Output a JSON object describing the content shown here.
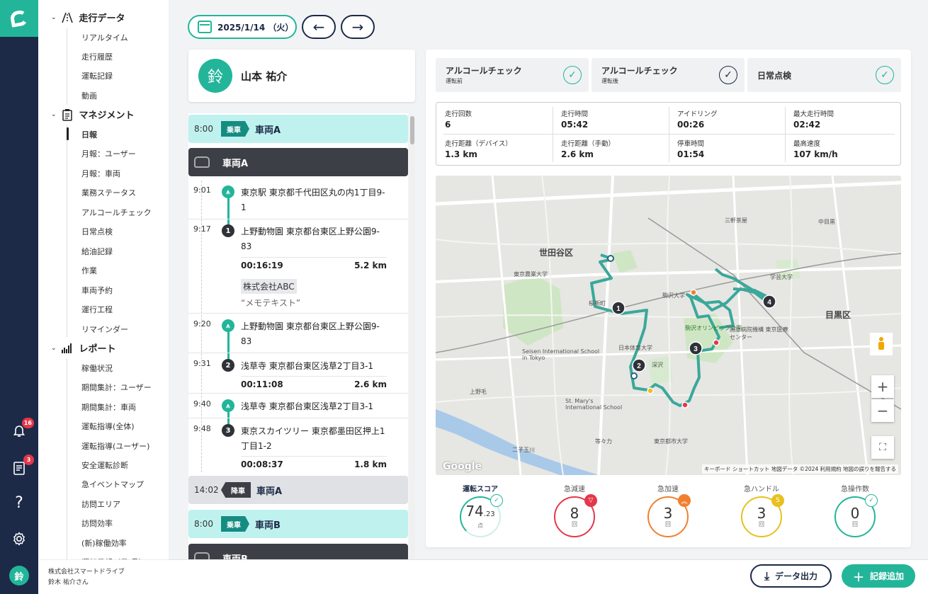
{
  "rail": {
    "notifications_badge": "16",
    "reports_badge": "3",
    "help_glyph": "?",
    "avatar_initial": "鈴"
  },
  "nav": {
    "sections": [
      {
        "label": "走行データ",
        "items": [
          "リアルタイム",
          "走行履歴",
          "運転記録",
          "動画"
        ]
      },
      {
        "label": "マネジメント",
        "items": [
          "日報",
          "月報：ユーザー",
          "月報：車両",
          "業務ステータス",
          "アルコールチェック",
          "日常点検",
          "給油記録",
          "作業",
          "車両予約",
          "運行工程",
          "リマインダー"
        ]
      },
      {
        "label": "レポート",
        "items": [
          "稼働状況",
          "期間集計：ユーザー",
          "期間集計：車両",
          "運転指導(全体)",
          "運転指導(ユーザー)",
          "安全運転診断",
          "急イベントマップ",
          "訪問エリア",
          "訪問効率",
          "(新)稼働効率",
          "運転日報（日/月）"
        ]
      }
    ],
    "active_item": "日報",
    "footer_company": "株式会社スマートドライブ",
    "footer_user": "鈴木 祐介さん"
  },
  "header": {
    "date": "2025/1/14 （火）",
    "prev_glyph": "←",
    "next_glyph": "→"
  },
  "driver": {
    "initial": "鈴",
    "name": "山本 祐介"
  },
  "timeline": {
    "ride1": {
      "time": "8:00",
      "tag": "乗車",
      "vehicle": "車両A"
    },
    "vehicle_header": "車両A",
    "stops": [
      {
        "time": "9:01",
        "marker": "start",
        "label": "東京駅 東京都千代田区丸の内1丁目9-1"
      },
      {
        "time": "9:17",
        "marker": "1",
        "label": "上野動物園 東京都台東区上野公園9-83"
      },
      {
        "time": "9:20",
        "marker": "start",
        "label": "上野動物園 東京都台東区上野公園9-83"
      },
      {
        "time": "9:31",
        "marker": "2",
        "label": "浅草寺 東京都台東区浅草2丁目3-1"
      },
      {
        "time": "9:40",
        "marker": "start",
        "label": "浅草寺 東京都台東区浅草2丁目3-1"
      },
      {
        "time": "9:48",
        "marker": "3",
        "label": "東京スカイツリー 東京都墨田区押上1丁目1-2"
      }
    ],
    "segments": [
      {
        "duration": "00:16:19",
        "distance": "5.2 km",
        "company": "株式会社ABC",
        "memo": "“メモテキスト”"
      },
      {
        "duration": "00:11:08",
        "distance": "2.6 km"
      },
      {
        "duration": "00:08:37",
        "distance": "1.8 km"
      }
    ],
    "drop": {
      "time": "14:02",
      "tag": "降車",
      "vehicle": "車両A"
    },
    "ride2": {
      "time": "8:00",
      "tag": "乗車",
      "vehicle": "車両B"
    },
    "vehicle_header_2": "車両B"
  },
  "checks": [
    {
      "title": "アルコールチェック",
      "sub": "運転前",
      "glyph": "✓"
    },
    {
      "title": "アルコールチェック",
      "sub": "運転後",
      "glyph": "✓"
    },
    {
      "title": "日常点検",
      "sub": "",
      "glyph": "✓"
    }
  ],
  "stats": [
    {
      "label": "走行回数",
      "value": "6"
    },
    {
      "label": "走行時間",
      "value": "05:42"
    },
    {
      "label": "アイドリング",
      "value": "00:26"
    },
    {
      "label": "最大走行時間",
      "value": "02:42"
    },
    {
      "label": "走行距離（デバイス）",
      "value": "1.3 km"
    },
    {
      "label": "走行距離（手動）",
      "value": "2.6 km"
    },
    {
      "label": "停車時間",
      "value": "01:54"
    },
    {
      "label": "最高速度",
      "value": "107 km/h"
    }
  ],
  "map": {
    "zoom_in": "+",
    "zoom_out": "−",
    "fullscreen": "⛶",
    "google_logo": "Google",
    "copyright": "キーボード ショートカット 地図データ ©2024 利用規約 地図の誤りを報告する",
    "route_markers": [
      "1",
      "2",
      "3",
      "4"
    ],
    "labels": [
      {
        "text": "世田谷区"
      },
      {
        "text": "目黒区"
      },
      {
        "text": "駒沢オリンピック公園"
      },
      {
        "text": "国立病院機構 東京医療センター"
      },
      {
        "text": "Seisen International School in Tokyo"
      },
      {
        "text": "St. Mary's International School"
      },
      {
        "text": "東京都市大学"
      },
      {
        "text": "日本体育大学"
      },
      {
        "text": "東京農業大学"
      },
      {
        "text": "桜新町"
      },
      {
        "text": "深沢"
      },
      {
        "text": "三軒茶屋"
      },
      {
        "text": "二子玉川"
      },
      {
        "text": "上野毛"
      },
      {
        "text": "駒沢大学"
      },
      {
        "text": "学芸大学"
      },
      {
        "text": "等々力"
      },
      {
        "text": "中目黒"
      }
    ],
    "colors": {
      "route": "#3aa89a",
      "accent": "#23b59a"
    }
  },
  "scores": [
    {
      "label": "運転スコア",
      "value": "74",
      "decimal": ".23",
      "unit": "点",
      "color": "#23b59a"
    },
    {
      "label": "急減速",
      "value": "8",
      "unit": "回",
      "color": "#e5374a"
    },
    {
      "label": "急加速",
      "value": "3",
      "unit": "回",
      "color": "#f08030"
    },
    {
      "label": "急ハンドル",
      "value": "3",
      "unit": "回",
      "color": "#e8c020"
    },
    {
      "label": "急操作数",
      "value": "0",
      "unit": "回",
      "color": "#23b59a"
    }
  ],
  "actions": {
    "export": "データ出力",
    "add": "記録追加"
  }
}
